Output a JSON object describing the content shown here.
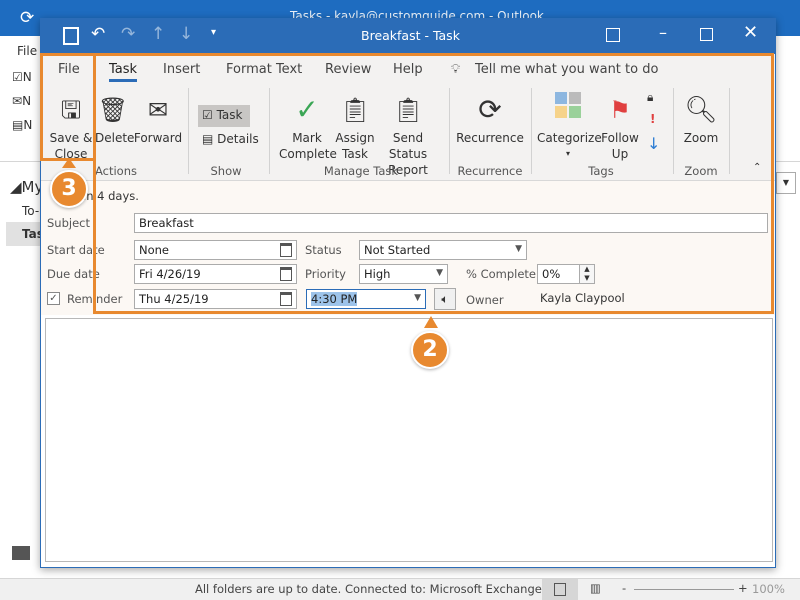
{
  "outer": {
    "title": "Tasks - kayla@customguide.com - Outlook",
    "file": "File",
    "nav_items": [
      "N",
      "N",
      "N"
    ],
    "folder": "My",
    "folder_items": [
      "To-",
      "Tas"
    ]
  },
  "dialog": {
    "title": "Breakfast  -  Task"
  },
  "ribbon": {
    "tabs": [
      "File",
      "Task",
      "Insert",
      "Format Text",
      "Review",
      "Help"
    ],
    "active_tab": "Task",
    "tell_me": "Tell me what you want to do",
    "buttons": {
      "save_close": "Save &\nClose",
      "delete": "Delete",
      "forward": "Forward",
      "task": "Task",
      "details": "Details",
      "mark_complete": "Mark\nComplete",
      "assign_task": "Assign\nTask",
      "send_status": "Send Status\nReport",
      "recurrence": "Recurrence",
      "categorize": "Categorize",
      "follow_up": "Follow\nUp",
      "zoom": "Zoom"
    },
    "groups": [
      "Actions",
      "Show",
      "Manage Task",
      "Recurrence",
      "Tags",
      "Zoom"
    ]
  },
  "form": {
    "info": "in 4 days.",
    "subject_label": "Subject",
    "subject": "Breakfast",
    "start_label": "Start date",
    "start": "None",
    "due_label": "Due date",
    "due": "Fri 4/26/19",
    "status_label": "Status",
    "status": "Not Started",
    "priority_label": "Priority",
    "priority": "High",
    "complete_label": "% Complete",
    "complete": "0%",
    "reminder_label": "Reminder",
    "reminder_checked": true,
    "reminder_date": "Thu 4/25/19",
    "reminder_time": "4:30 PM",
    "owner_label": "Owner",
    "owner": "Kayla Claypool"
  },
  "status": {
    "sync": "All folders are up to date.",
    "connection": "Connected to: Microsoft Exchange",
    "zoom": "100%"
  },
  "callouts": [
    "3",
    "2"
  ],
  "colors": {
    "titlebar": "#2b6cb7",
    "highlight": "#e8892f",
    "ribbon": "#f3f2f1"
  }
}
